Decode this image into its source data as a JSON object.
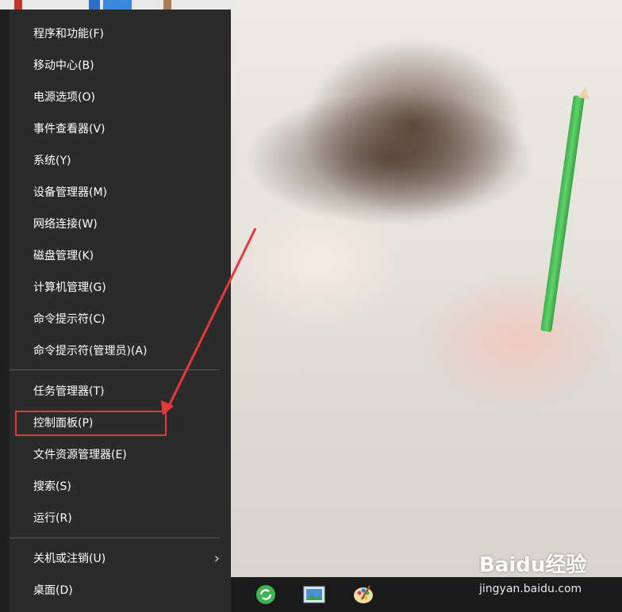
{
  "menu": {
    "items": [
      {
        "label": "程序和功能(F)"
      },
      {
        "label": "移动中心(B)"
      },
      {
        "label": "电源选项(O)"
      },
      {
        "label": "事件查看器(V)"
      },
      {
        "label": "系统(Y)"
      },
      {
        "label": "设备管理器(M)"
      },
      {
        "label": "网络连接(W)"
      },
      {
        "label": "磁盘管理(K)"
      },
      {
        "label": "计算机管理(G)"
      },
      {
        "label": "命令提示符(C)"
      },
      {
        "label": "命令提示符(管理员)(A)"
      },
      {
        "label": "任务管理器(T)"
      },
      {
        "label": "控制面板(P)"
      },
      {
        "label": "文件资源管理器(E)"
      },
      {
        "label": "搜索(S)"
      },
      {
        "label": "运行(R)"
      },
      {
        "label": "关机或注销(U)"
      },
      {
        "label": "桌面(D)"
      }
    ]
  },
  "taskbar": {
    "icons": [
      "refresh-green-icon",
      "picture-viewer-icon",
      "paint-palette-icon"
    ]
  },
  "watermark": {
    "logo": "Baidu经验",
    "url": "jingyan.baidu.com"
  },
  "colors": {
    "menu_bg": "#2b2b2b",
    "menu_text": "#ffffff",
    "highlight": "#e8383b",
    "taskbar_bg": "#1a1a1a"
  }
}
